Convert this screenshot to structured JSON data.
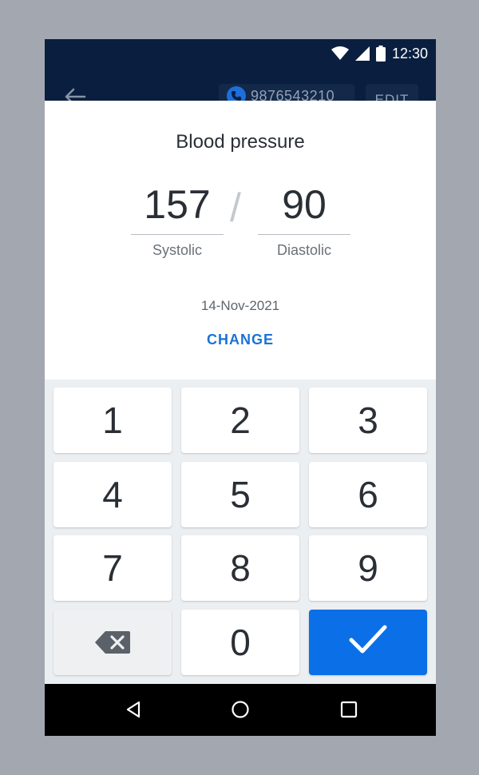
{
  "status_bar": {
    "time": "12:30",
    "icons": [
      "wifi-icon",
      "signal-icon",
      "battery-icon"
    ]
  },
  "app_bar": {
    "back_icon": "arrow-left-icon",
    "phone_number": "9876543210",
    "edit_label": "EDIT"
  },
  "dialog": {
    "title": "Blood pressure",
    "systolic": {
      "value": "157",
      "label": "Systolic"
    },
    "separator": "/",
    "diastolic": {
      "value": "90",
      "label": "Diastolic"
    },
    "date": "14-Nov-2021",
    "change_label": "CHANGE"
  },
  "keypad": {
    "keys": [
      "1",
      "2",
      "3",
      "4",
      "5",
      "6",
      "7",
      "8",
      "9",
      "0"
    ],
    "delete_icon": "backspace-icon",
    "confirm_icon": "checkmark-icon"
  },
  "nav_bar": {
    "icons": [
      "nav-back-icon",
      "nav-home-icon",
      "nav-recents-icon"
    ]
  },
  "colors": {
    "app_bar_bg": "#0a1f3f",
    "accent": "#1a73d6",
    "confirm_key": "#0b6fe8",
    "keypad_bg": "#eceff1",
    "backdrop": "#a3a8b0"
  }
}
